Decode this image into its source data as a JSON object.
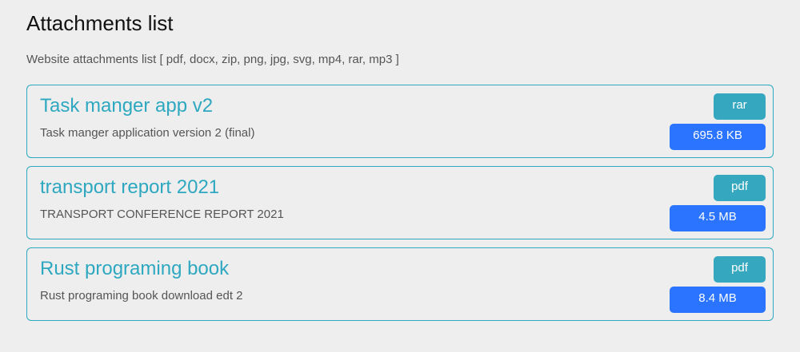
{
  "page": {
    "title": "Attachments list",
    "subtitle": "Website attachments list [ pdf, docx, zip, png, jpg, svg, mp4, rar, mp3 ]"
  },
  "items": [
    {
      "title": "Task manger app v2",
      "description": "Task manger application version 2 (final)",
      "type": "rar",
      "size": "695.8 KB"
    },
    {
      "title": "transport report 2021",
      "description": "TRANSPORT CONFERENCE REPORT 2021",
      "type": "pdf",
      "size": "4.5 MB"
    },
    {
      "title": "Rust programing book",
      "description": "Rust programing book download edt 2",
      "type": "pdf",
      "size": "8.4 MB"
    }
  ]
}
